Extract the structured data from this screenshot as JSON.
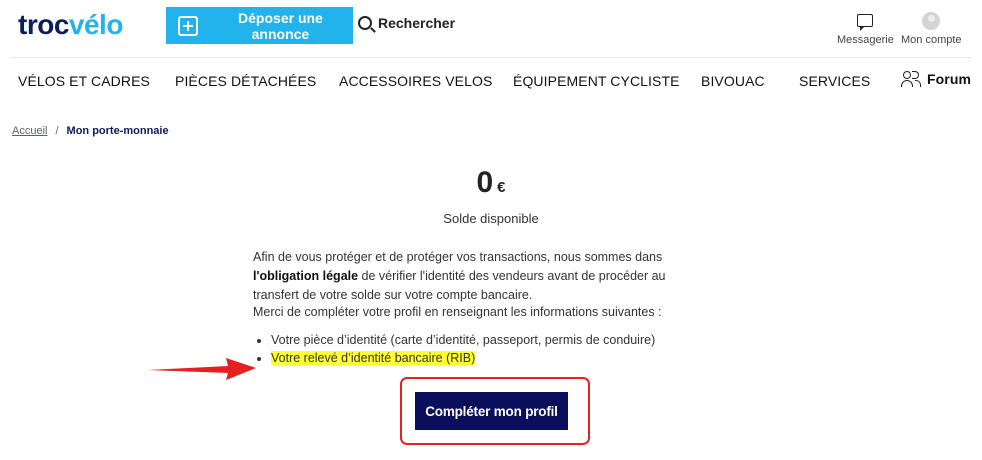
{
  "brand": {
    "logo_part1": "troc",
    "logo_part2": "vélo",
    "primary_color": "#0b1e5b",
    "accent_color": "#22b3ec"
  },
  "header": {
    "post_ad_label": "Déposer une annonce",
    "search_label": "Rechercher",
    "messages_label": "Messagerie",
    "account_label": "Mon compte"
  },
  "nav": {
    "items": [
      {
        "label": "VÉLOS ET CADRES"
      },
      {
        "label": "PIÈCES DÉTACHÉES"
      },
      {
        "label": "ACCESSOIRES VELOS"
      },
      {
        "label": "ÉQUIPEMENT CYCLISTE"
      },
      {
        "label": "BIVOUAC"
      },
      {
        "label": "SERVICES"
      }
    ],
    "forum_label": "Forum"
  },
  "breadcrumb": {
    "home": "Accueil",
    "separator": "/",
    "current": "Mon porte-monnaie"
  },
  "wallet": {
    "balance": "0",
    "currency": "€",
    "balance_label": "Solde disponible"
  },
  "info": {
    "p1_before": "Afin de vous protéger et de protéger vos transactions, nous sommes dans ",
    "p1_bold": "l'obligation légale",
    "p1_after": " de vérifier l'identité des vendeurs avant de procéder au transfert de votre solde sur votre compte bancaire.",
    "p2": "Merci de compléter votre profil en renseignant les informations suivantes :",
    "requirements": [
      "Votre pièce d’identité (carte d’identité, passeport, permis de conduire)",
      "Votre relevé d’identité bancaire (RIB)"
    ]
  },
  "cta": {
    "label": "Compléter mon profil",
    "button_color": "#0a0f5c",
    "frame_color": "#e02424"
  },
  "annotation": {
    "arrow_color": "#e81f1f",
    "highlight_color": "#ffff33"
  }
}
